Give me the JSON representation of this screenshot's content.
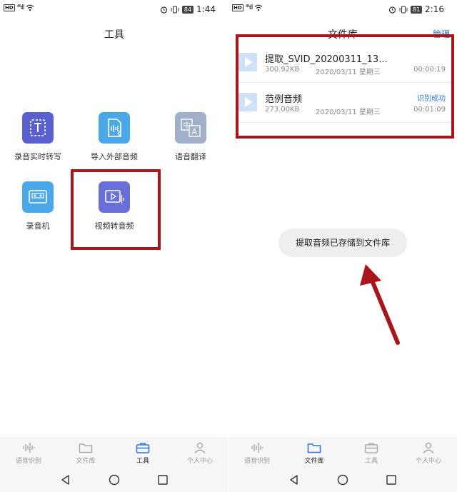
{
  "left": {
    "status": {
      "hd": "HD",
      "signal": "⁴⁶ıll",
      "battery": "84",
      "time": "1:44"
    },
    "title": "工具",
    "tools": [
      {
        "label": "录音实时转写",
        "icon": "text-t-icon",
        "color": "#5a5fd0"
      },
      {
        "label": "导入外部音频",
        "icon": "import-audio-icon",
        "color": "#4aa8e8"
      },
      {
        "label": "语音翻译",
        "icon": "translate-icon",
        "color": "#9fb0c8"
      },
      {
        "label": "录音机",
        "icon": "recorder-icon",
        "color": "#4aa8e8"
      },
      {
        "label": "视频转音频",
        "icon": "video-to-audio-icon",
        "color": "#6a6fd8"
      }
    ],
    "nav": [
      {
        "label": "语音识别",
        "icon": "waveform-icon"
      },
      {
        "label": "文件库",
        "icon": "folder-icon"
      },
      {
        "label": "工具",
        "icon": "toolbox-icon"
      },
      {
        "label": "个人中心",
        "icon": "person-icon"
      }
    ],
    "active_nav": 2
  },
  "right": {
    "status": {
      "hd": "HD",
      "signal": "⁴⁶ıll",
      "battery": "81",
      "time": "2:16"
    },
    "title": "文件库",
    "manage_label": "管理",
    "files": [
      {
        "name": "提取_SVID_20200311_13...",
        "size": "300.92KB",
        "date": "2020/03/11 星期三",
        "duration": "00:00:19",
        "status": ""
      },
      {
        "name": "范例音频",
        "size": "273.00KB",
        "date": "2020/03/11 星期三",
        "duration": "00:01:09",
        "status": "识别成功"
      }
    ],
    "toast": "提取音频已存储到文件库",
    "nav": [
      {
        "label": "语音识别",
        "icon": "waveform-icon"
      },
      {
        "label": "文件库",
        "icon": "folder-icon"
      },
      {
        "label": "工具",
        "icon": "toolbox-icon"
      },
      {
        "label": "个人中心",
        "icon": "person-icon"
      }
    ],
    "active_nav": 1
  },
  "colors": {
    "accent": "#2a7be4",
    "highlight": "#a9151b",
    "nav_bg": "#f6f6f6"
  }
}
